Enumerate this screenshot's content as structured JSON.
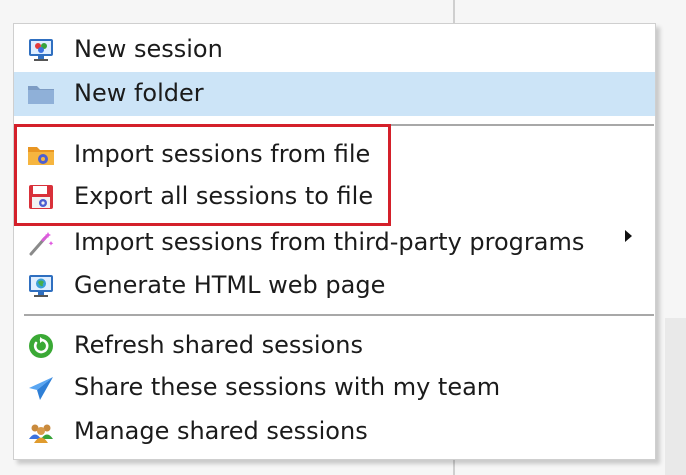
{
  "menu": {
    "items": [
      {
        "label": "New session",
        "icon": "new-session-icon"
      },
      {
        "label": "New folder",
        "icon": "folder-icon",
        "hovered": true
      },
      {
        "label": "Import sessions from file",
        "icon": "import-folder-icon"
      },
      {
        "label": "Export all sessions to file",
        "icon": "export-save-icon"
      },
      {
        "label": "Import sessions from third-party programs",
        "icon": "magic-wand-icon",
        "has_submenu": true
      },
      {
        "label": "Generate HTML web page",
        "icon": "web-globe-icon"
      },
      {
        "label": "Refresh shared sessions",
        "icon": "refresh-icon"
      },
      {
        "label": "Share these sessions with my team",
        "icon": "share-paper-plane-icon"
      },
      {
        "label": "Manage shared sessions",
        "icon": "team-users-icon"
      }
    ]
  },
  "colors": {
    "highlight_border": "#d4202a",
    "hover_background": "#cce4f7",
    "refresh_green": "#3aa935",
    "share_blue": "#3b8ee8",
    "folder_orange": "#f3a53b"
  }
}
